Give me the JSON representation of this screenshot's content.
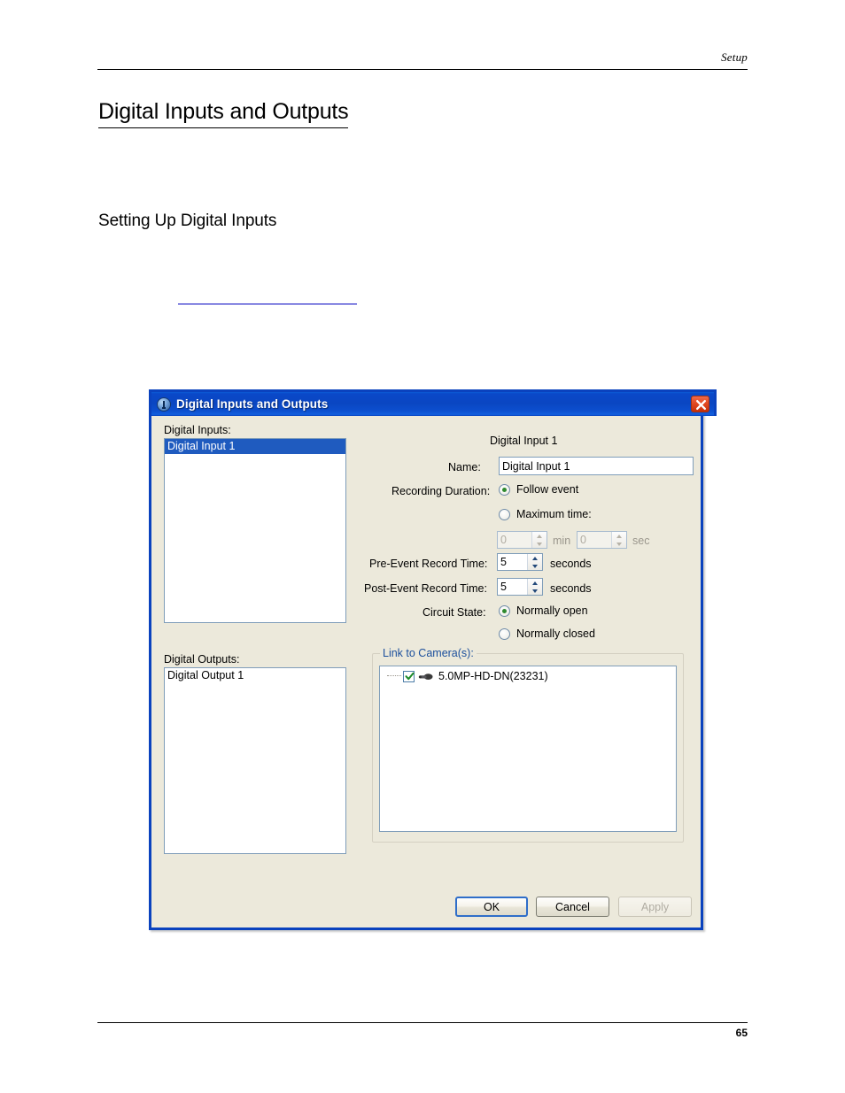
{
  "page": {
    "running_header": "Setup",
    "title": "Digital Inputs and Outputs",
    "subtitle": "Setting Up Digital Inputs",
    "cross_reference_link": "",
    "page_number": "65"
  },
  "dialog": {
    "title": "Digital Inputs and Outputs",
    "title_icon": "info-circle-icon",
    "close_icon": "close-icon",
    "inputs_label": "Digital Inputs:",
    "inputs_list": [
      "Digital Input 1"
    ],
    "inputs_selected_index": 0,
    "outputs_label": "Digital Outputs:",
    "outputs_list": [
      "Digital Output 1"
    ],
    "detail_heading": "Digital Input 1",
    "name_label": "Name:",
    "name_value": "Digital Input 1",
    "recording_duration_label": "Recording Duration:",
    "follow_event_label": "Follow event",
    "follow_event_selected": true,
    "maximum_time_label": "Maximum time:",
    "maximum_time_selected": false,
    "max_minutes_value": "0",
    "max_minutes_unit": "min",
    "max_seconds_value": "0",
    "max_seconds_unit": "sec",
    "pre_event_label": "Pre-Event Record Time:",
    "pre_event_value": "5",
    "pre_event_unit": "seconds",
    "post_event_label": "Post-Event Record Time:",
    "post_event_value": "5",
    "post_event_unit": "seconds",
    "circuit_state_label": "Circuit State:",
    "normally_open_label": "Normally open",
    "normally_open_selected": true,
    "normally_closed_label": "Normally closed",
    "normally_closed_selected": false,
    "link_cameras_label": "Link to Camera(s):",
    "camera_item_label": "5.0MP-HD-DN(23231)",
    "camera_item_checked": true,
    "camera_icon": "camera-icon",
    "ok_label": "OK",
    "cancel_label": "Cancel",
    "apply_label": "Apply",
    "apply_enabled": false
  },
  "colors": {
    "titlebar_blue": "#0A46C2",
    "dialog_face": "#ECE9DB",
    "selection_blue": "#1F5BBF",
    "link_blue": "#0000C0",
    "group_title_blue": "#1B4F9C",
    "radio_dot_green": "#2F8A2F",
    "close_red": "#E24A22"
  }
}
